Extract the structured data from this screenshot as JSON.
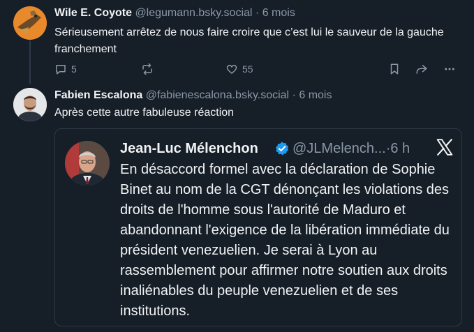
{
  "posts": [
    {
      "author_name": "Wile E. Coyote",
      "handle": "@legumann.bsky.social",
      "separator": "·",
      "time": "6 mois",
      "text": "Sérieusement arrêtez de nous faire croire que c’est lui le sauveur de la gauche franchement",
      "reply_count": "5",
      "like_count": "55"
    },
    {
      "author_name": "Fabien Escalona",
      "handle": "@fabienescalona.bsky.social",
      "separator": "·",
      "time": "6 mois",
      "text": "Après cette autre fabuleuse réaction"
    }
  ],
  "embed": {
    "author_name": "Jean-Luc Mélenchon",
    "handle_time": "@JLMelench...·6 h",
    "text": "En désaccord formel avec la déclaration de Sophie Binet au nom de la CGT dénonçant les violations des droits de l'homme sous l'autorité de Maduro et abandonnant l'exigence de la libération immédiate du président venezuelien. Je serai à Lyon au rassemblement pour affirmer notre soutien aux droits inaliénables du peuple venezuelien et de ses institutions."
  },
  "colors": {
    "background": "#161e27",
    "muted": "#8a98a8",
    "verified": "#1d9bf0"
  }
}
